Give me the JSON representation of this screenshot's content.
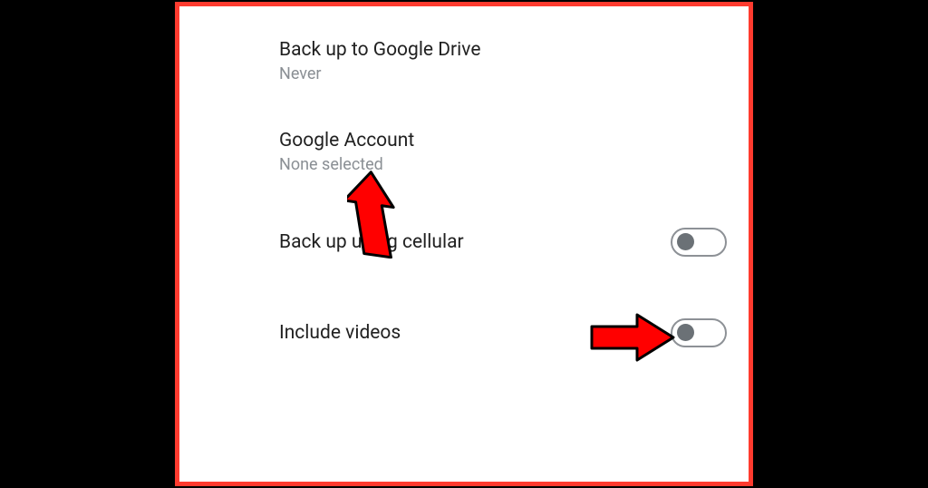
{
  "settings": {
    "backup_drive": {
      "label": "Back up to Google Drive",
      "value": "Never"
    },
    "google_account": {
      "label": "Google Account",
      "value": "None selected"
    },
    "backup_cellular": {
      "label": "Back up using cellular",
      "state": "off"
    },
    "include_videos": {
      "label": "Include videos",
      "state": "off"
    }
  },
  "annotations": {
    "arrow_up_points_to": "google_account_value",
    "arrow_right_points_to": "include_videos_toggle"
  }
}
